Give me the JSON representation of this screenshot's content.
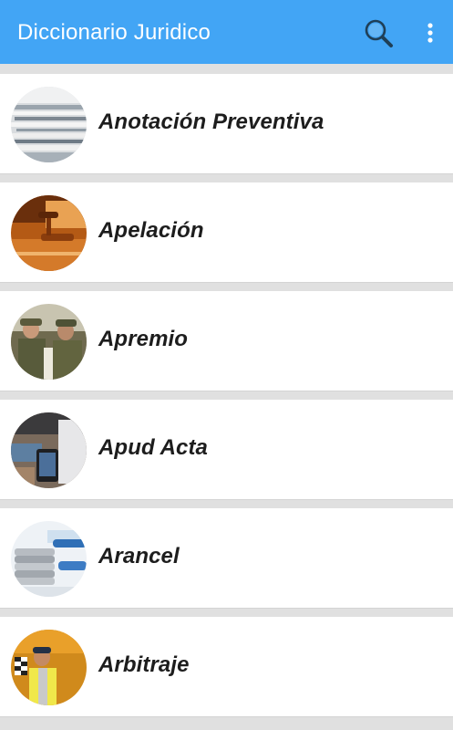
{
  "app": {
    "title": "Diccionario Juridico",
    "accent_color": "#42a5f5"
  },
  "toolbar": {
    "search_icon": "search-icon",
    "more_icon": "more-vertical-icon"
  },
  "terms": [
    {
      "label": "Anotación Preventiva",
      "image": "stacked-documents"
    },
    {
      "label": "Apelación",
      "image": "judge-gavel"
    },
    {
      "label": "Apremio",
      "image": "soldiers"
    },
    {
      "label": "Apud Acta",
      "image": "laptop-and-phone"
    },
    {
      "label": "Arancel",
      "image": "coins-and-pen"
    },
    {
      "label": "Arbitraje",
      "image": "race-flag-marshal"
    }
  ]
}
